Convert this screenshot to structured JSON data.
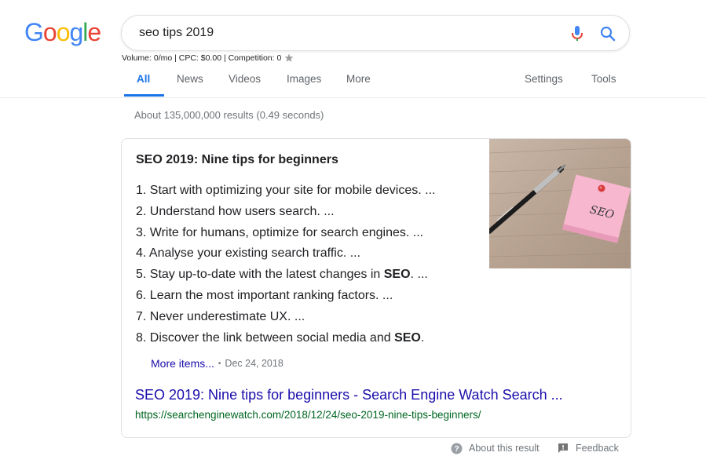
{
  "logo": {
    "letters": [
      "G",
      "o",
      "o",
      "g",
      "l",
      "e"
    ],
    "colors": [
      "#4285F4",
      "#EA4335",
      "#FBBC05",
      "#4285F4",
      "#34A853",
      "#EA4335"
    ]
  },
  "search": {
    "value": "seo tips 2019",
    "mic_icon": "microphone-icon",
    "search_icon": "magnifier-icon"
  },
  "volume_line": "Volume: 0/mo | CPC: $0.00 | Competition: 0",
  "tabs": [
    {
      "label": "All",
      "active": true
    },
    {
      "label": "News"
    },
    {
      "label": "Videos"
    },
    {
      "label": "Images"
    },
    {
      "label": "More"
    },
    {
      "label": "Settings"
    },
    {
      "label": "Tools"
    }
  ],
  "result_stats": "About 135,000,000 results (0.49 seconds)",
  "snippet": {
    "title": "SEO 2019: Nine tips for beginners",
    "items": [
      {
        "prefix": "1. Start with optimizing your site for mobile devices. ...",
        "bold": "",
        "suffix": ""
      },
      {
        "prefix": "2. Understand how users search. ...",
        "bold": "",
        "suffix": ""
      },
      {
        "prefix": "3. Write for humans, optimize for search engines. ...",
        "bold": "",
        "suffix": ""
      },
      {
        "prefix": "4. Analyse your existing search traffic. ...",
        "bold": "",
        "suffix": ""
      },
      {
        "prefix": "5. Stay up-to-date with the latest changes in ",
        "bold": "SEO",
        "suffix": ". ..."
      },
      {
        "prefix": "6. Learn the most important ranking factors. ...",
        "bold": "",
        "suffix": ""
      },
      {
        "prefix": "7. Never underestimate UX. ...",
        "bold": "",
        "suffix": ""
      },
      {
        "prefix": "8. Discover the link between social media and ",
        "bold": "SEO",
        "suffix": "."
      }
    ],
    "more_items": "More items...",
    "separator": "•",
    "date": "Dec 24, 2018",
    "image_note_text": "SEO",
    "result_title": "SEO 2019: Nine tips for beginners - Search Engine Watch Search ...",
    "result_url": "https://searchenginewatch.com/2018/12/24/seo-2019-nine-tips-beginners/"
  },
  "footer": {
    "about": "About this result",
    "feedback": "Feedback"
  },
  "colors": {
    "link_blue": "#1a0dab",
    "active_tab_blue": "#1a73e8",
    "url_green": "#006621",
    "muted_gray": "#70757a"
  }
}
